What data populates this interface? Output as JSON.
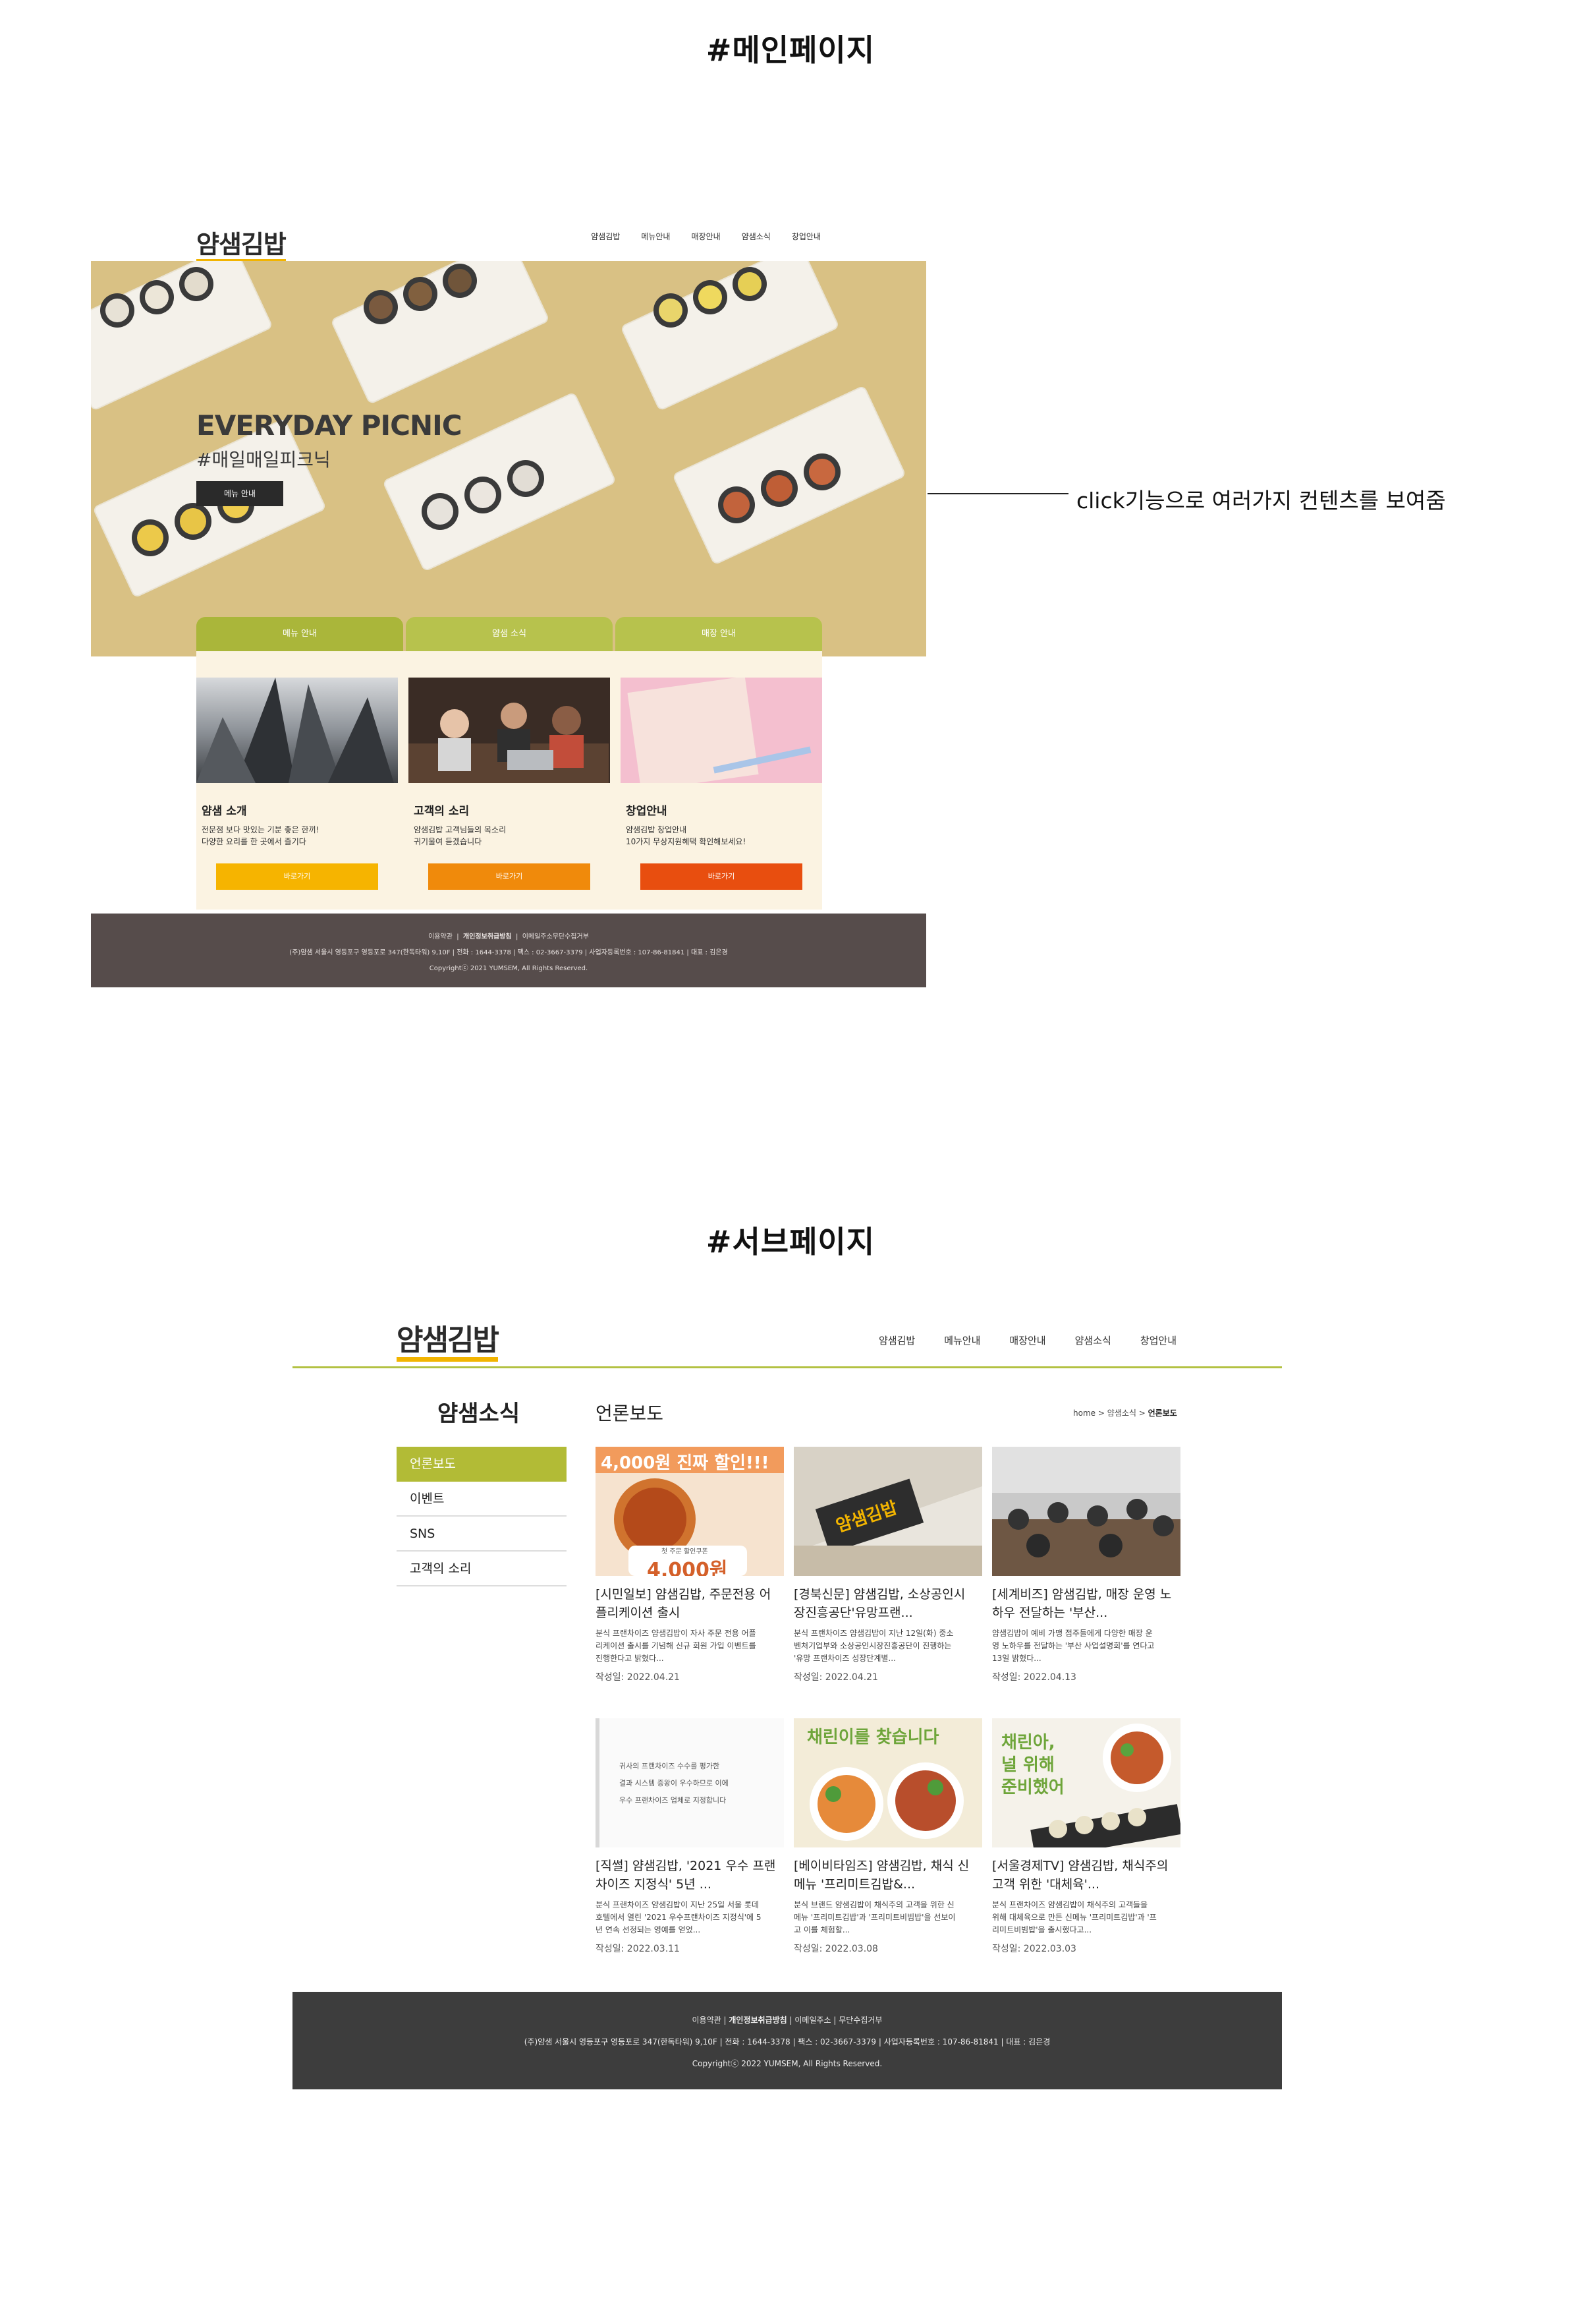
{
  "main_section": {
    "heading": "#메인페이지"
  },
  "sub_section": {
    "heading": "#서브페이지"
  },
  "callout": {
    "text": "click기능으로 여러가지 컨텐츠를 보여줌"
  },
  "main_page": {
    "logo": "얌샘김밥",
    "nav": [
      "얌샘김밥",
      "메뉴안내",
      "매장안내",
      "얌샘소식",
      "창업안내"
    ],
    "hero": {
      "title": "EVERYDAY PICNIC",
      "subtitle": "#매일매일피크닉",
      "button": "메뉴 안내"
    },
    "tabs": [
      "메뉴 안내",
      "얌샘 소식",
      "매장 안내"
    ],
    "cards": [
      {
        "title": "얌샘 소개",
        "desc1": "전문점 보다 맛있는 기분 좋은 한끼!",
        "desc2": "다양한 요리를 한 곳에서 즐기다",
        "button": "바로가기",
        "color": "#f6b400"
      },
      {
        "title": "고객의 소리",
        "desc1": "얌샘김밥 고객님들의 목소리",
        "desc2": "귀기울여 듣겠습니다",
        "button": "바로가기",
        "color": "#f08a0b"
      },
      {
        "title": "창업안내",
        "desc1": "얌샘김밥 창업안내",
        "desc2": "10가지 무상지원혜택 확인해보세요!",
        "button": "바로가기",
        "color": "#e84e0f"
      }
    ],
    "footer": {
      "links": [
        "이용약관",
        "개인정보취급방침",
        "이메일주소무단수집거부"
      ],
      "info": "(주)얌샘 서울시 영등포구 영등포로 347(한독타워) 9,10F | 전화 : 1644-3378 | 팩스 : 02-3667-3379 | 사업자등록번호 : 107-86-81841 | 대표 : 김은경",
      "copyright": "Copyrightⓒ 2021 YUMSEM, All Rights Reserved."
    }
  },
  "sub_page": {
    "logo": "얌샘김밥",
    "nav": [
      "얌샘김밥",
      "메뉴안내",
      "매장안내",
      "얌샘소식",
      "창업안내"
    ],
    "section_title": "얌샘소식",
    "side_menu": [
      "언론보도",
      "이벤트",
      "SNS",
      "고객의 소리"
    ],
    "content_title": "언론보도",
    "breadcrumb": {
      "home": "home",
      "sep": ">",
      "parent": "얌샘소식",
      "current": "언론보도"
    },
    "news": [
      {
        "title1": "[시민일보] 얌샘김밥, 주문전용 어",
        "title2": "플리케이션 출시",
        "desc1": "분식 프랜차이즈 얌샘김밥이 자사 주문 전용 어플",
        "desc2": "리케이션 출시를 기념해 신규 회원 가입 이벤트를",
        "desc3": "진행한다고 밝혔다...",
        "date": "작성일: 2022.04.21",
        "img_text1": "4,000원 진짜 할인!!!",
        "img_text2": "첫 주문 할인쿠폰",
        "img_text3": "4,000원"
      },
      {
        "title1": "[경북신문] 얌샘김밥, 소상공인시",
        "title2": "장진흥공단'유망프랜...",
        "desc1": "분식 프랜차이즈 얌샘김밥이 지난 12일(화) 중소",
        "desc2": "벤처기업부와 소상공인시장진흥공단이 진행하는",
        "desc3": "'유망 프랜차이즈 성장단계별...",
        "date": "작성일: 2022.04.21",
        "img_text1": "얌샘김밥"
      },
      {
        "title1": "[세계비즈] 얌샘김밥, 매장 운영 노",
        "title2": "하우 전달하는 '부산...",
        "desc1": "얌샘김밥이 예비 가맹 점주들에게 다양한 매장 운",
        "desc2": "영 노하우를 전달하는 '부산 사업설명회'를 연다고",
        "desc3": "13일 밝혔다...",
        "date": "작성일: 2022.04.13"
      },
      {
        "title1": "[직썰] 얌샘김밥, '2021 우수 프랜",
        "title2": "차이즈 지정식' 5년 ...",
        "desc1": "분식 프랜차이즈 얌샘김밥이 지난 25일 서울 롯데",
        "desc2": "호텔에서 열린 '2021 우수프랜차이즈 지정식'에 5",
        "desc3": "년 연속 선정되는 영예를 얻었...",
        "date": "작성일: 2022.03.11",
        "img_text1": "귀사의 프랜차이즈 수수를 평가한",
        "img_text2": "결과 시스템 증왕이 우수하므로 이에",
        "img_text3": "우수 프랜차이즈 업체로 지정합니다"
      },
      {
        "title1": "[베이비타임즈] 얌샘김밥, 채식 신",
        "title2": "메뉴 '프리미트김밥&...",
        "desc1": "분식 브랜드 얌샘김밥이 채식주의 고객을 위한 신",
        "desc2": "메뉴 '프리미트김밥'과 '프리미트비빔밥'을 선보이",
        "desc3": "고 이를 체험할...",
        "date": "작성일: 2022.03.08",
        "img_text1": "채린이를 찾습니다"
      },
      {
        "title1": "[서울경제TV] 얌샘김밥, 채식주의",
        "title2": "고객 위한 '대체육'...",
        "desc1": "분식 프랜차이즈 얌샘김밥이 채식주의 고객들을",
        "desc2": "위해 대체육으로 만든 신메뉴 '프리미트김밥'과 '프",
        "desc3": "리미트비빔밥'을 출시했다고...",
        "date": "작성일: 2022.03.03",
        "img_text1": "채린아,",
        "img_text2": "널 위해",
        "img_text3": "준비했어"
      }
    ],
    "footer": {
      "links": [
        "이용약관",
        "개인정보취급방침",
        "이메일주소",
        "무단수집거부"
      ],
      "info": "(주)얌샘 서울시 영등포구 영등포로 347(한독타워) 9,10F | 전화 : 1644-3378 | 팩스 : 02-3667-3379 | 사업자등록번호 : 107-86-81841 | 대표 : 김은경",
      "copyright": "Copyrightⓒ 2022 YUMSEM, All Rights Reserved."
    }
  },
  "colors": {
    "accent_green": "#b3c142",
    "footer_main": "#564c4b",
    "footer_sub": "#3d3d3d",
    "hero_bg": "#d9c184",
    "cards_bg": "#fbf3e2"
  }
}
